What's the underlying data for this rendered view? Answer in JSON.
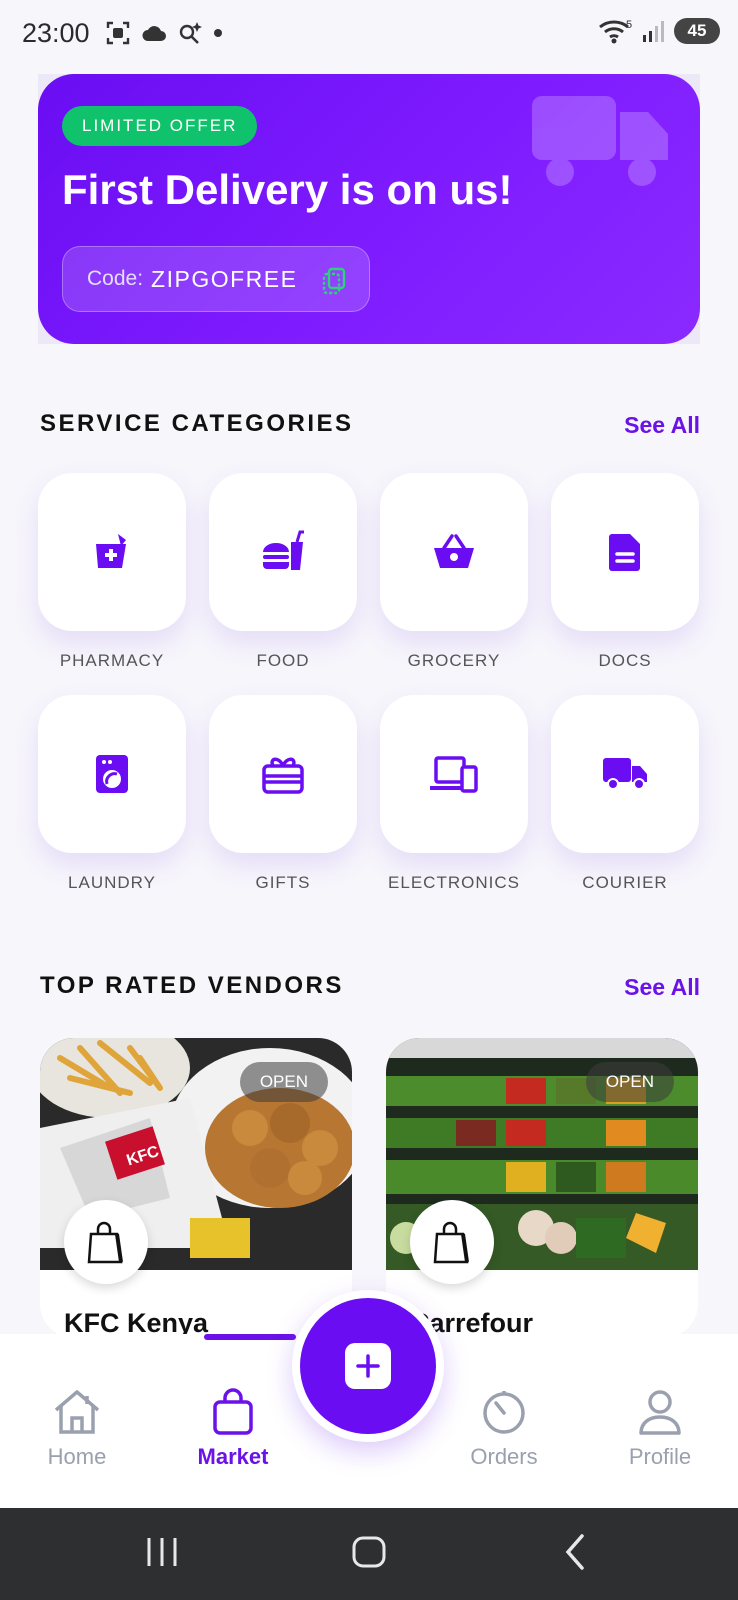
{
  "status_bar": {
    "time": "23:00",
    "battery": "45",
    "icons": [
      "screenshot-icon",
      "cloud-icon",
      "sparkle-search-icon",
      "dot-icon",
      "wifi-icon",
      "signal-icon"
    ]
  },
  "promo": {
    "badge": "LIMITED OFFER",
    "title": "First Delivery is on us!",
    "code_label": "Code:",
    "code_value": "ZIPGOFREE",
    "accent": "#7a12ff",
    "badge_color": "#10c26b"
  },
  "categories": {
    "title": "SERVICE CATEGORIES",
    "see_all": "See All",
    "items": [
      {
        "label": "PHARMACY",
        "icon": "pharmacy-icon"
      },
      {
        "label": "FOOD",
        "icon": "food-icon"
      },
      {
        "label": "GROCERY",
        "icon": "basket-icon"
      },
      {
        "label": "DOCS",
        "icon": "document-icon"
      },
      {
        "label": "LAUNDRY",
        "icon": "washing-machine-icon"
      },
      {
        "label": "GIFTS",
        "icon": "gift-icon"
      },
      {
        "label": "ELECTRONICS",
        "icon": "devices-icon"
      },
      {
        "label": "COURIER",
        "icon": "truck-icon"
      }
    ]
  },
  "vendors": {
    "title": "TOP RATED VENDORS",
    "see_all": "See All",
    "items": [
      {
        "name": "KFC Kenya",
        "status": "OPEN"
      },
      {
        "name": "Carrefour",
        "status": "OPEN"
      }
    ]
  },
  "bottom_nav": {
    "items": [
      {
        "label": "Home",
        "icon": "home-icon",
        "active": false
      },
      {
        "label": "Market",
        "icon": "shopping-bag-icon",
        "active": true
      },
      {
        "label": "Orders",
        "icon": "timer-icon",
        "active": false
      },
      {
        "label": "Profile",
        "icon": "user-icon",
        "active": false
      }
    ],
    "fab_icon": "plus-icon"
  },
  "colors": {
    "primary": "#6a12e8",
    "background": "#f7f6fb"
  }
}
